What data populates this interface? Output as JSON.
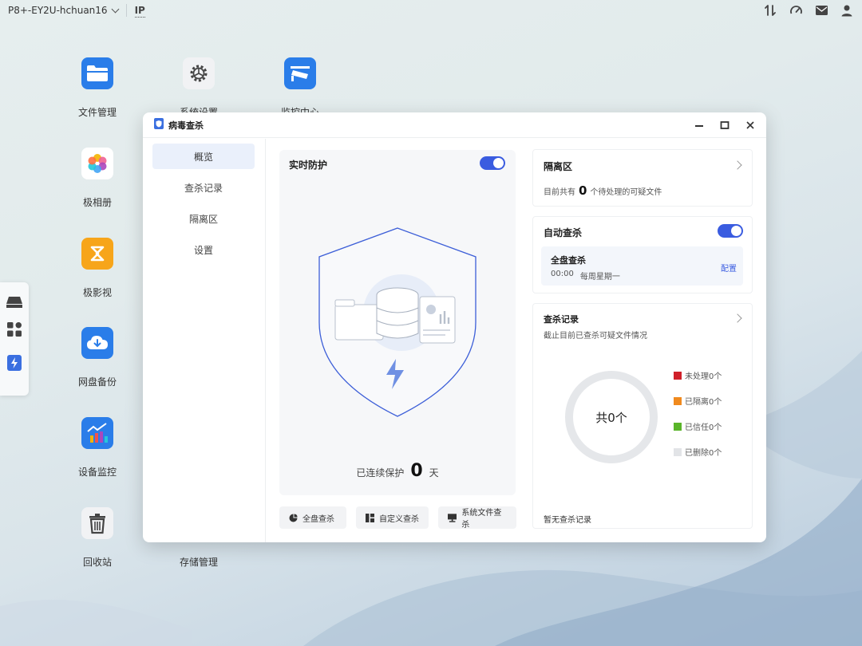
{
  "topbar": {
    "device_name": "P8+-EY2U-hchuan16",
    "ip_label": "IP"
  },
  "desktop": {
    "icons": [
      {
        "label": "文件管理"
      },
      {
        "label": "系统设置"
      },
      {
        "label": "监控中心"
      },
      {
        "label": "极相册"
      },
      {
        "label": "极影视"
      },
      {
        "label": "网盘备份"
      },
      {
        "label": "设备监控"
      },
      {
        "label": "回收站"
      },
      {
        "label": "存储管理"
      }
    ]
  },
  "window": {
    "title": "病毒查杀",
    "nav": [
      "概览",
      "查杀记录",
      "隔离区",
      "设置"
    ],
    "realtime": {
      "title": "实时防护",
      "enabled": true
    },
    "protect": {
      "prefix": "已连续保护",
      "days": "0",
      "suffix": "天"
    },
    "buttons": [
      "全盘查杀",
      "自定义查杀",
      "系统文件查杀"
    ],
    "quarantine": {
      "title": "隔离区",
      "prefix": "目前共有",
      "count": "0",
      "suffix": "个待处理的可疑文件"
    },
    "auto_scan": {
      "title": "自动查杀",
      "enabled": true,
      "task_name": "全盘查杀",
      "time": "00:00",
      "schedule": "每周星期一",
      "config_label": "配置"
    },
    "records": {
      "title": "查杀记录",
      "subtitle": "截止目前已查杀可疑文件情况",
      "total_label": "共0个",
      "legend": [
        {
          "label": "未处理0个",
          "color": "#d0202a"
        },
        {
          "label": "已隔离0个",
          "color": "#f08a1e"
        },
        {
          "label": "已信任0个",
          "color": "#5ab52a"
        },
        {
          "label": "已删除0个",
          "color": "#e2e4e7"
        }
      ],
      "empty_text": "暂无查杀记录"
    }
  },
  "colors": {
    "accent": "#3a5ce0"
  }
}
